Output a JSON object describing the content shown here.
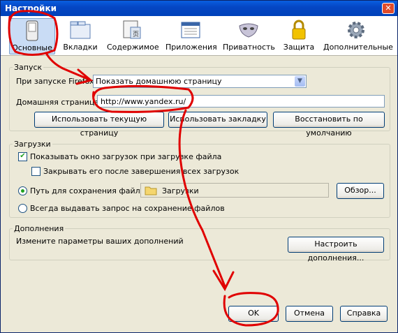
{
  "window": {
    "title": "Настройки",
    "close_glyph": "✕"
  },
  "toolbar": {
    "items": [
      {
        "label": "Основные",
        "icon": "switch-icon",
        "selected": true
      },
      {
        "label": "Вкладки",
        "icon": "tabs-icon"
      },
      {
        "label": "Содержимое",
        "icon": "content-icon"
      },
      {
        "label": "Приложения",
        "icon": "applications-icon"
      },
      {
        "label": "Приватность",
        "icon": "mask-icon"
      },
      {
        "label": "Защита",
        "icon": "lock-icon"
      },
      {
        "label": "Дополнительные",
        "icon": "gear-icon"
      }
    ]
  },
  "startup": {
    "legend": "Запуск",
    "when_start_label": "При запуске Firefox:",
    "when_start_value": "Показать домашнюю страницу",
    "homepage_label": "Домашняя страница:",
    "homepage_value": "http://www.yandex.ru/",
    "use_current": "Использовать текущую страницу",
    "use_bookmark": "Использовать закладку",
    "restore_default": "Восстановить по умолчанию"
  },
  "downloads": {
    "legend": "Загрузки",
    "show_window": "Показывать окно загрузок при загрузке файла",
    "close_after": "Закрывать его после завершения всех загрузок",
    "save_path_label": "Путь для сохранения файлов",
    "save_path_value": "Загрузки",
    "browse": "Обзор...",
    "always_ask": "Всегда выдавать запрос на сохранение файлов"
  },
  "addons": {
    "legend": "Дополнения",
    "description": "Измените параметры ваших дополнений",
    "manage": "Настроить дополнения..."
  },
  "footer": {
    "ok": "OK",
    "cancel": "Отмена",
    "help": "Справка"
  },
  "colors": {
    "annotation": "#e00000",
    "title_bar": "#0546c4",
    "dialog_bg": "#ece9d8"
  }
}
